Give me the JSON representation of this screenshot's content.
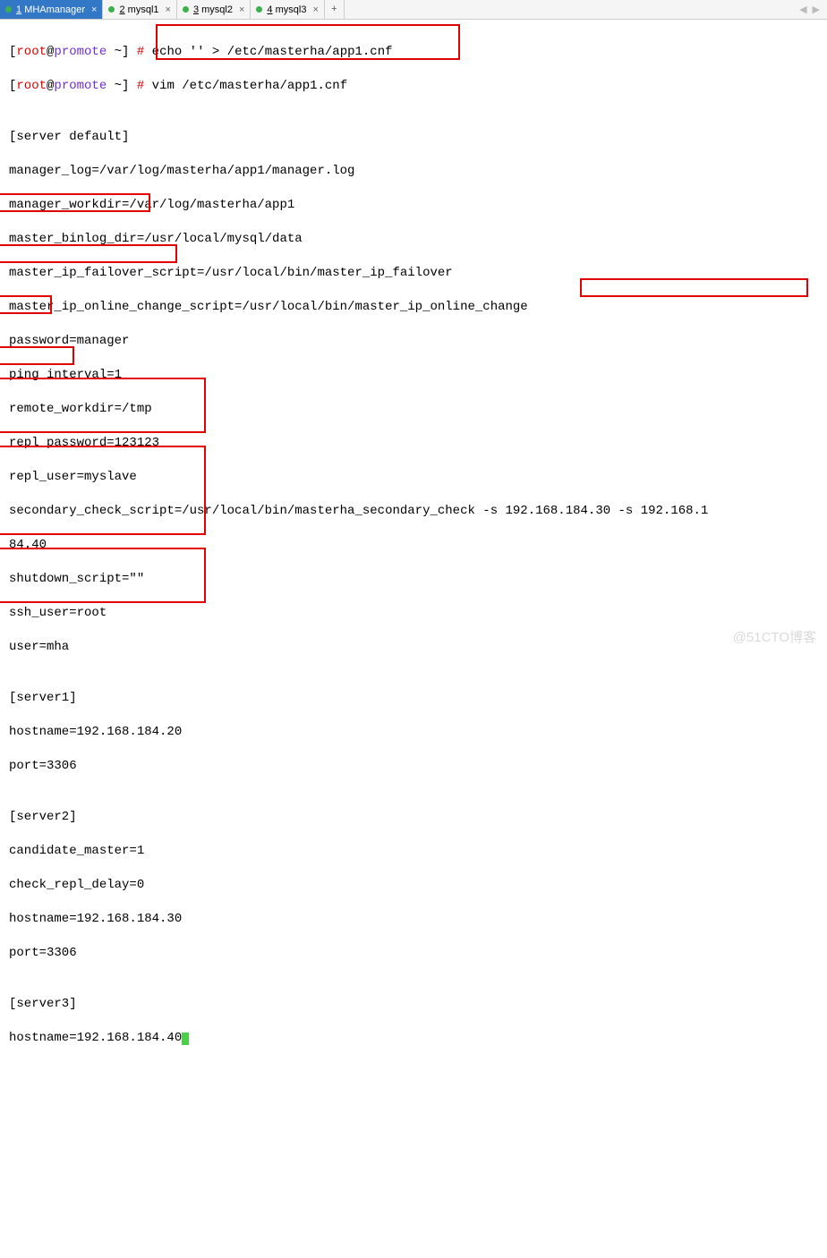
{
  "tabs": [
    {
      "num": "1",
      "label": "MHAmanager",
      "active": true
    },
    {
      "num": "2",
      "label": "mysql1",
      "active": false
    },
    {
      "num": "3",
      "label": "mysql2",
      "active": false
    },
    {
      "num": "4",
      "label": "mysql3",
      "active": false
    }
  ],
  "add_tab": "+",
  "nav_prev": "◀",
  "nav_next": "▶",
  "prompt": {
    "open": "[",
    "root": "root",
    "at": "@",
    "host": "promote",
    "tail": " ~]",
    "hash": " #"
  },
  "commands": {
    "c1": " echo '' > /etc/masterha/app1.cnf",
    "c2": " vim /etc/masterha/app1.cnf"
  },
  "config": {
    "l0": "",
    "l1": "[server default]",
    "l2": "manager_log=/var/log/masterha/app1/manager.log",
    "l3": "manager_workdir=/var/log/masterha/app1",
    "l4": "master_binlog_dir=/usr/local/mysql/data",
    "l5": "master_ip_failover_script=/usr/local/bin/master_ip_failover",
    "l6": "master_ip_online_change_script=/usr/local/bin/master_ip_online_change",
    "l7": "password=manager",
    "l8": "ping_interval=1",
    "l9": "remote_workdir=/tmp",
    "l10": "repl_password=123123",
    "l11": "repl_user=myslave",
    "l12a": "secondary_check_script=/usr/local/bin/masterha_secondary_check -s ",
    "l12b": "192.168.184.30 -s 192.168.1",
    "l13": "84.40",
    "l14": "shutdown_script=\"\"",
    "l15": "ssh_user=root",
    "l16": "user=mha",
    "l17": "",
    "l18": "[server1]",
    "l19": "hostname=192.168.184.20",
    "l20": "port=3306",
    "l21": "",
    "l22": "[server2]",
    "l23": "candidate_master=1",
    "l24": "check_repl_delay=0",
    "l25": "hostname=192.168.184.30",
    "l26": "port=3306",
    "l27": "",
    "l28": "[server3]",
    "l29": "hostname=192.168.184.40"
  },
  "watermark": "@51CTO博客"
}
